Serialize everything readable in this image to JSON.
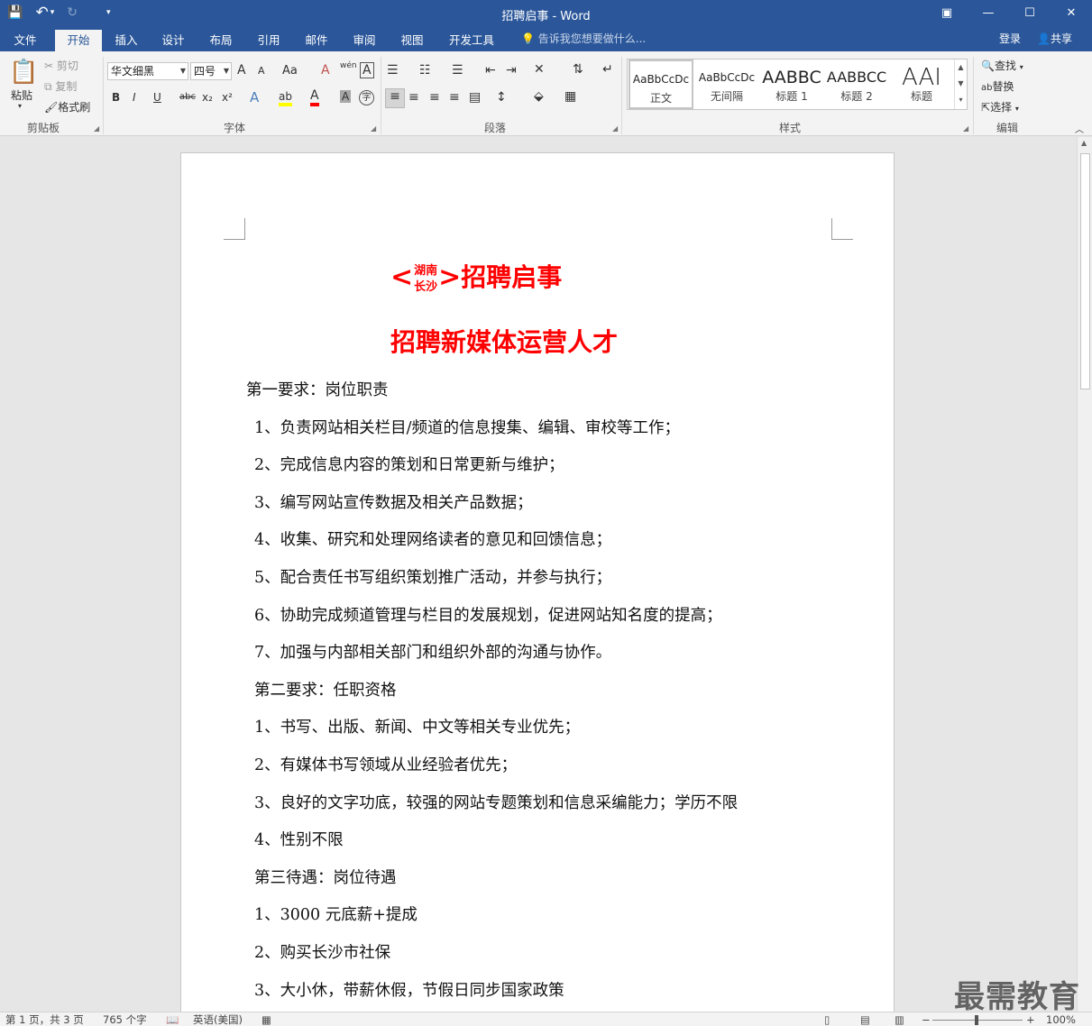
{
  "window": {
    "title": "招聘启事 - Word",
    "controls": {
      "restore_ribbon": "▣",
      "minimize": "—",
      "maximize": "☐",
      "close": "✕"
    }
  },
  "qat": {
    "save": "💾",
    "undo": "↶",
    "undo_dropdown": "▾",
    "redo": "↻",
    "customize": "▾"
  },
  "tabs": [
    "文件",
    "开始",
    "插入",
    "设计",
    "布局",
    "引用",
    "邮件",
    "审阅",
    "视图",
    "开发工具"
  ],
  "active_tab": "开始",
  "tell_me": "告诉我您想要做什么...",
  "account": {
    "login": "登录",
    "share": "共享"
  },
  "ribbon": {
    "clipboard": {
      "label": "剪贴板",
      "paste": "粘贴",
      "cut": "剪切",
      "copy": "复制",
      "format_painter": "格式刷"
    },
    "font": {
      "label": "字体",
      "name": "华文细黑",
      "size": "四号",
      "grow": "A",
      "shrink": "A",
      "case": "Aa",
      "clear": "A",
      "phonetic": "wén",
      "border": "A",
      "bold": "B",
      "italic": "I",
      "underline": "U",
      "strike": "abc",
      "sub": "x₂",
      "sup": "x²",
      "effects": "A",
      "highlight": "ab",
      "color": "A",
      "shading": "A",
      "enclose": "字"
    },
    "paragraph": {
      "label": "段落"
    },
    "styles": {
      "label": "样式",
      "items": [
        {
          "preview": "AaBbCcDc",
          "name": "正文"
        },
        {
          "preview": "AaBbCcDc",
          "name": "无间隔"
        },
        {
          "preview": "AABBC",
          "name": "标题 1"
        },
        {
          "preview": "AABBCC",
          "name": "标题 2"
        },
        {
          "preview": "AAI",
          "name": "标题"
        }
      ]
    },
    "editing": {
      "label": "编辑",
      "find": "查找",
      "replace": "替换",
      "select": "选择"
    }
  },
  "document": {
    "title_open": "<",
    "title_top": "湖南",
    "title_bottom": "长沙",
    "title_close": ">",
    "title_text": "招聘启事",
    "subtitle": "招聘新媒体运营人才",
    "paragraphs": [
      "第一要求：岗位职责",
      "1、负责网站相关栏目/频道的信息搜集、编辑、审校等工作；",
      "2、完成信息内容的策划和日常更新与维护；",
      "3、编写网站宣传数据及相关产品数据；",
      "4、收集、研究和处理网络读者的意见和回馈信息；",
      "5、配合责任书写组织策划推广活动，并参与执行；",
      "6、协助完成频道管理与栏目的发展规划，促进网站知名度的提高；",
      "7、加强与内部相关部门和组织外部的沟通与协作。",
      "第二要求：任职资格",
      "1、书写、出版、新闻、中文等相关专业优先；",
      "2、有媒体书写领域从业经验者优先；",
      "3、良好的文字功底，较强的网站专题策划和信息采编能力；学历不限",
      "4、性别不限",
      "第三待遇：岗位待遇",
      "1、3000 元底薪+提成",
      "2、购买长沙市社保",
      "3、大小休，带薪休假，节假日同步国家政策"
    ]
  },
  "statusbar": {
    "page": "第 1 页，共 3 页",
    "words": "765 个字",
    "language": "英语(美国)",
    "zoom": "100%",
    "zoom_minus": "−",
    "zoom_plus": "+"
  },
  "watermark": "最需教育",
  "colors": {
    "brand": "#2b579a",
    "title_red": "#ff0000"
  }
}
